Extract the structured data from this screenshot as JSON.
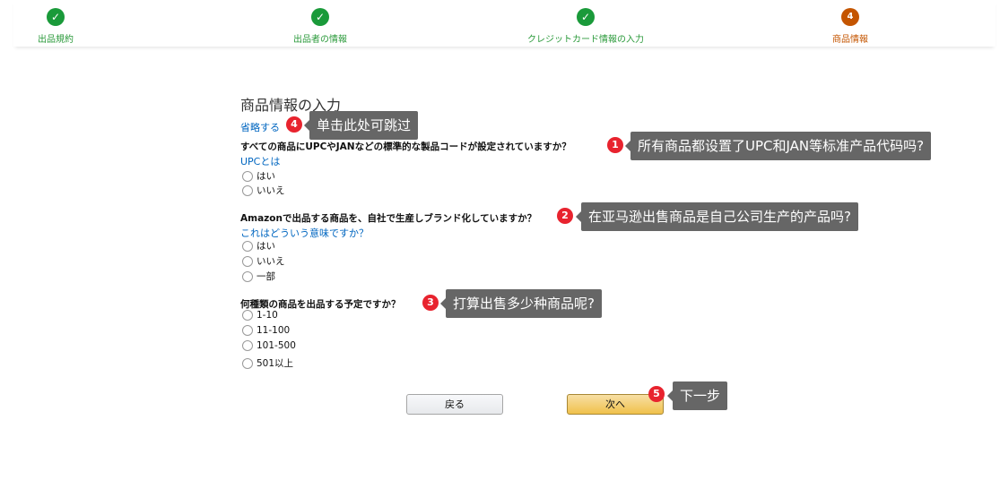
{
  "steps": [
    {
      "label": "出品規約",
      "status": "done"
    },
    {
      "label": "出品者の情報",
      "status": "done"
    },
    {
      "label": "クレジットカード情報の入力",
      "status": "done"
    },
    {
      "label": "商品情報",
      "status": "current",
      "number": "4"
    }
  ],
  "form": {
    "title": "商品情報の入力",
    "skip_link": "省略する",
    "q1": {
      "text": "すべての商品にUPCやJANなどの標準的な製品コードが設定されていますか？",
      "help": "UPCとは",
      "options": [
        "はい",
        "いいえ"
      ]
    },
    "q2": {
      "text": "Amazonで出品する商品を、自社で生産しブランド化していますか？",
      "help": "これはどういう意味ですか？",
      "options": [
        "はい",
        "いいえ",
        "一部"
      ]
    },
    "q3": {
      "text": "何種類の商品を出品する予定ですか？",
      "options": [
        "1-10",
        "11-100",
        "101-500",
        "501以上"
      ]
    },
    "back_label": "戻る",
    "next_label": "次へ"
  },
  "annotations": [
    {
      "num": "1",
      "text": "所有商品都设置了UPC和JAN等标准产品代码吗?"
    },
    {
      "num": "2",
      "text": "在亚马逊出售商品是自己公司生产的产品吗?"
    },
    {
      "num": "3",
      "text": "打算出售多少种商品呢?"
    },
    {
      "num": "4",
      "text": "单击此处可跳过"
    },
    {
      "num": "5",
      "text": "下一步"
    }
  ],
  "colors": {
    "done": "#1a9a3a",
    "current": "#c45500",
    "link": "#0066c0",
    "badge": "#e8232e"
  }
}
